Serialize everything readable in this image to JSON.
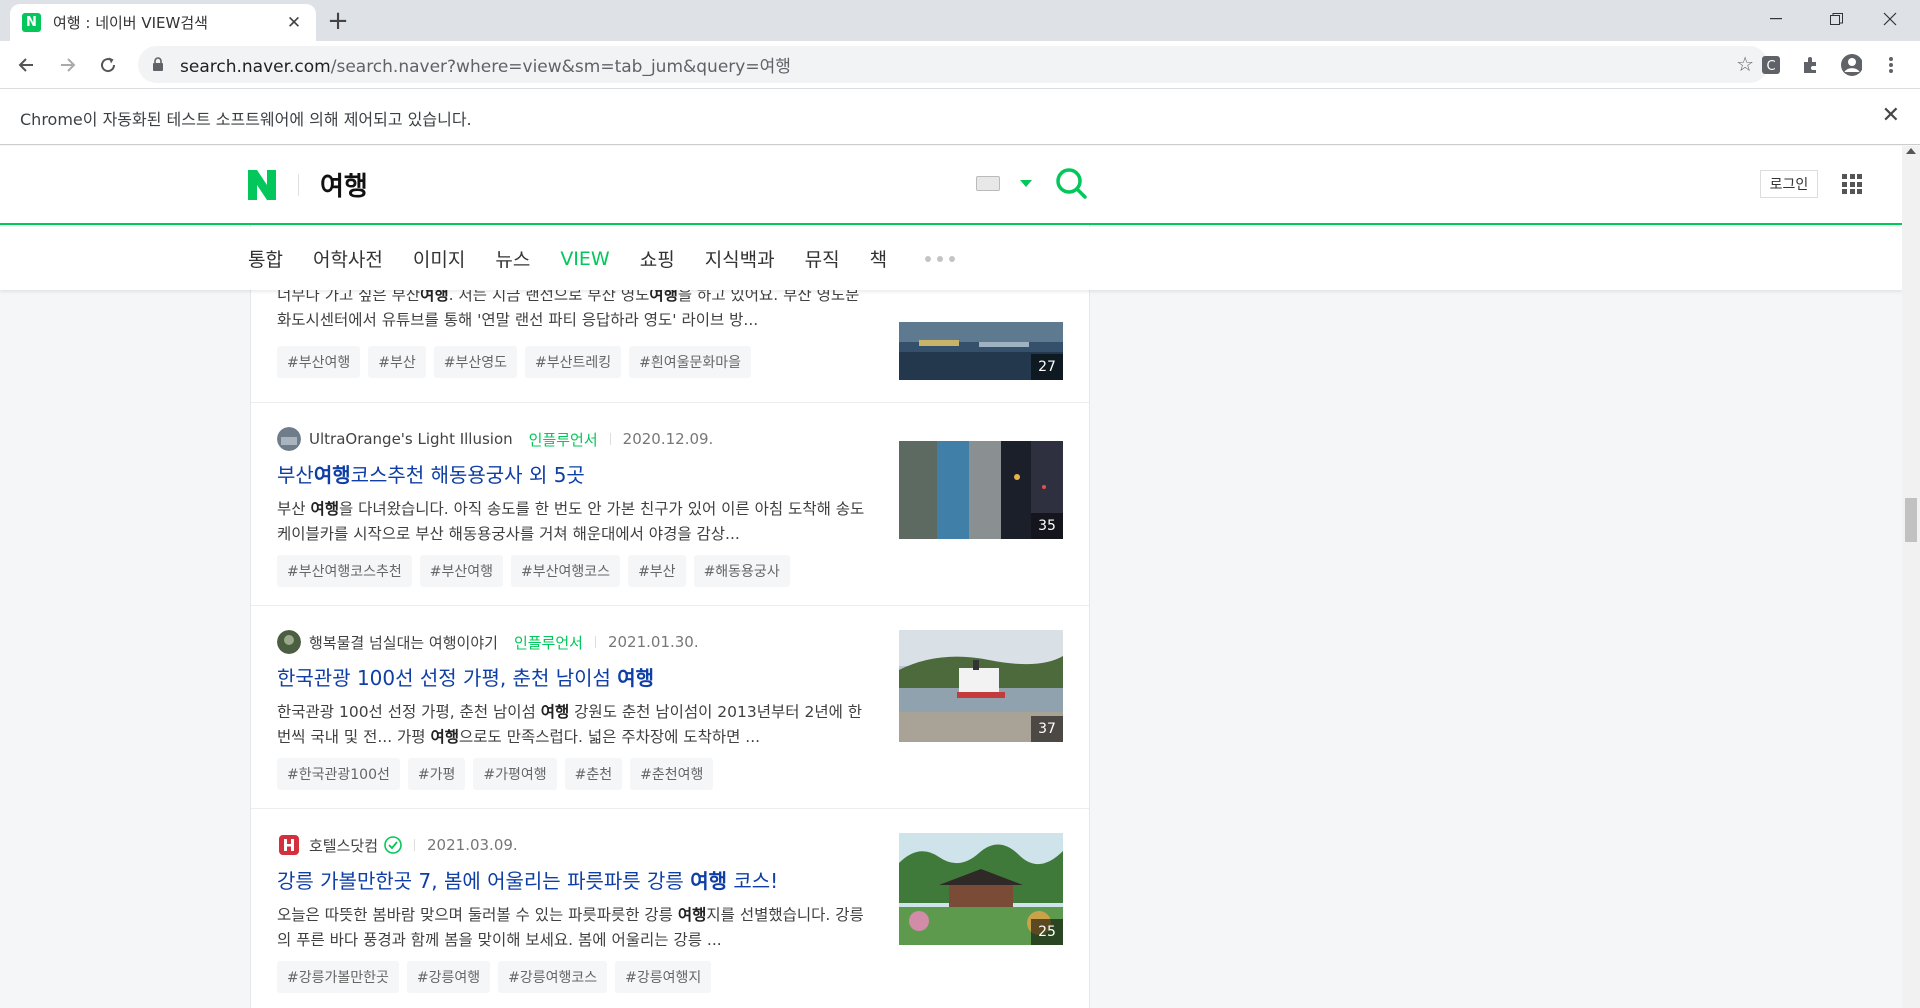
{
  "browser": {
    "tab_title": "여행 : 네이버 VIEW검색",
    "favicon_letter": "N",
    "url_host": "search.naver.com",
    "url_path": "/search.naver?where=view&sm=tab_jum&query=여행",
    "infobar_text": "Chrome이 자동화된 테스트 소프트웨어에 의해 제어되고 있습니다.",
    "ext_letter": "C"
  },
  "header": {
    "query": "여행",
    "login_label": "로그인"
  },
  "nav": {
    "tabs": [
      "통합",
      "어학사전",
      "이미지",
      "뉴스",
      "VIEW",
      "쇼핑",
      "지식백과",
      "뮤직",
      "책"
    ],
    "active": "VIEW"
  },
  "results": [
    {
      "desc_parts": [
        {
          "t": "너무나 가고 싶은 부산"
        },
        {
          "t": "여행",
          "b": true
        },
        {
          "t": ". 저는 지금 랜선으로 부산 영도"
        },
        {
          "t": "여행",
          "b": true
        },
        {
          "t": "을 하고 있어요. 부산 영도문화도시센터에서 유튜브를 통해 '연말 랜선 파티 응답하라 영도' 라이브 방..."
        }
      ],
      "tags": [
        "#부산여행",
        "#부산",
        "#부산영도",
        "#부산트레킹",
        "#흰여울문화마을"
      ],
      "image_count": "27"
    },
    {
      "author": "UltraOrange's Light Illusion",
      "badge": "인플루언서",
      "date": "2020.12.09.",
      "title_parts": [
        {
          "t": "부산"
        },
        {
          "t": "여행",
          "b": true
        },
        {
          "t": "코스추천 해동용궁사 외 5곳"
        }
      ],
      "desc_parts": [
        {
          "t": "부산 "
        },
        {
          "t": "여행",
          "b": true
        },
        {
          "t": "을 다녀왔습니다. 아직 송도를 한 번도 안 가본 친구가 있어 이른 아침 도착해 송도 케이블카를 시작으로 부산 해동용궁사를 거쳐 해운대에서 야경을 감상..."
        }
      ],
      "tags": [
        "#부산여행코스추천",
        "#부산여행",
        "#부산여행코스",
        "#부산",
        "#해동용궁사"
      ],
      "image_count": "35"
    },
    {
      "author": "행복물결 넘실대는 여행이야기",
      "badge": "인플루언서",
      "date": "2021.01.30.",
      "title_parts": [
        {
          "t": "한국관광 100선 선정 가평, 춘천 남이섬 "
        },
        {
          "t": "여행",
          "b": true
        }
      ],
      "desc_parts": [
        {
          "t": "한국관광 100선 선정 가평, 춘천 남이섬 "
        },
        {
          "t": "여행",
          "b": true
        },
        {
          "t": " 강원도 춘천 남이섬이 2013년부터 2년에 한 번씩 국내 및 전... 가평 "
        },
        {
          "t": "여행",
          "b": true
        },
        {
          "t": "으로도 만족스럽다. 넓은 주차장에 도착하면 ..."
        }
      ],
      "tags": [
        "#한국관광100선",
        "#가평",
        "#가평여행",
        "#춘천",
        "#춘천여행"
      ],
      "image_count": "37"
    },
    {
      "author": "호텔스닷컴",
      "badge": "",
      "date": "2021.03.09.",
      "title_parts": [
        {
          "t": "강릉 가볼만한곳 7, 봄에 어울리는 파릇파릇 강릉 "
        },
        {
          "t": "여행",
          "b": true
        },
        {
          "t": " 코스!"
        }
      ],
      "desc_parts": [
        {
          "t": "오늘은 따뜻한 봄바람 맞으며 둘러볼 수 있는 파릇파릇한 강릉 "
        },
        {
          "t": "여행",
          "b": true
        },
        {
          "t": "지를 선별했습니다. 강릉의 푸른 바다 풍경과 함께 봄을 맞이해 보세요.     봄에 어울리는 강릉 ..."
        }
      ],
      "tags": [
        "#강릉가볼만한곳",
        "#강릉여행",
        "#강릉여행코스",
        "#강릉여행지"
      ],
      "image_count": "25"
    }
  ],
  "colors": {
    "naver_green": "#03c75a",
    "title_blue": "#0e3ea6"
  }
}
